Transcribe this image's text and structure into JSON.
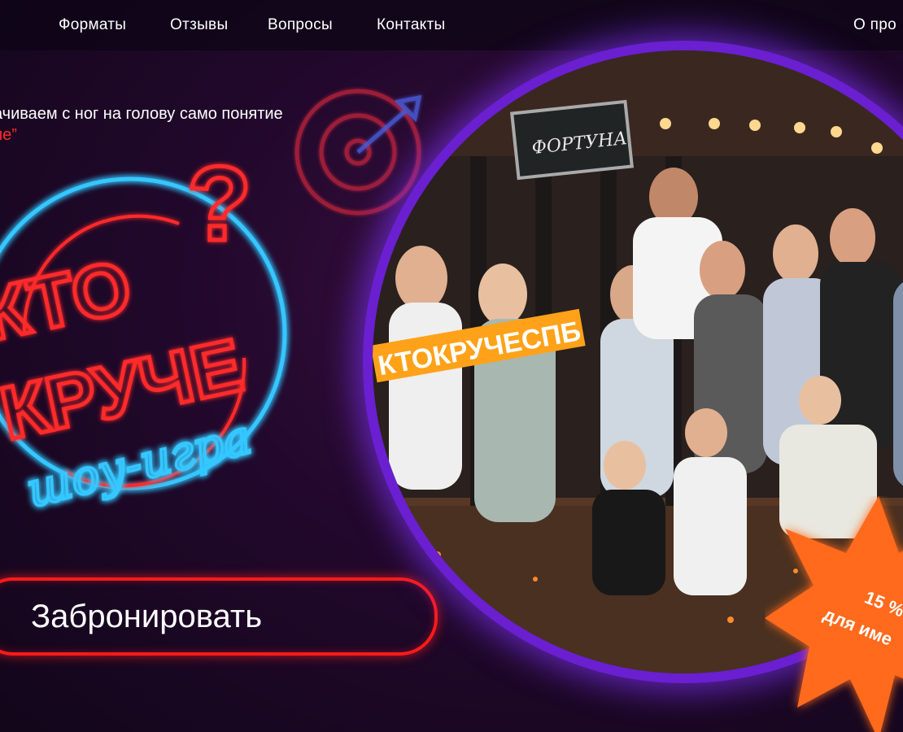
{
  "nav": {
    "items": [
      {
        "label": "Форматы"
      },
      {
        "label": "Отзывы"
      },
      {
        "label": "Вопросы"
      },
      {
        "label": "Контакты"
      },
      {
        "label": "О про"
      }
    ]
  },
  "hero": {
    "tagline_line1": "ачиваем с ног на голову само понятие",
    "tagline_line2": "ие”",
    "logo": {
      "word1": "КТО",
      "word2": "КРУЧЕ",
      "word3": "шоу-игра",
      "question": "?"
    },
    "book_button": "Забронировать"
  },
  "photo": {
    "sign_top": "ФОРТУНА",
    "sign_orange": "КТОКРУЧЕСПБ"
  },
  "badge": {
    "line1": "15 %",
    "line2": "для име"
  },
  "colors": {
    "accent_red": "#ff1a1a",
    "neon_blue": "#36c7ff",
    "ring_purple": "#6a1fd0",
    "badge_orange": "#ff6a1a"
  }
}
